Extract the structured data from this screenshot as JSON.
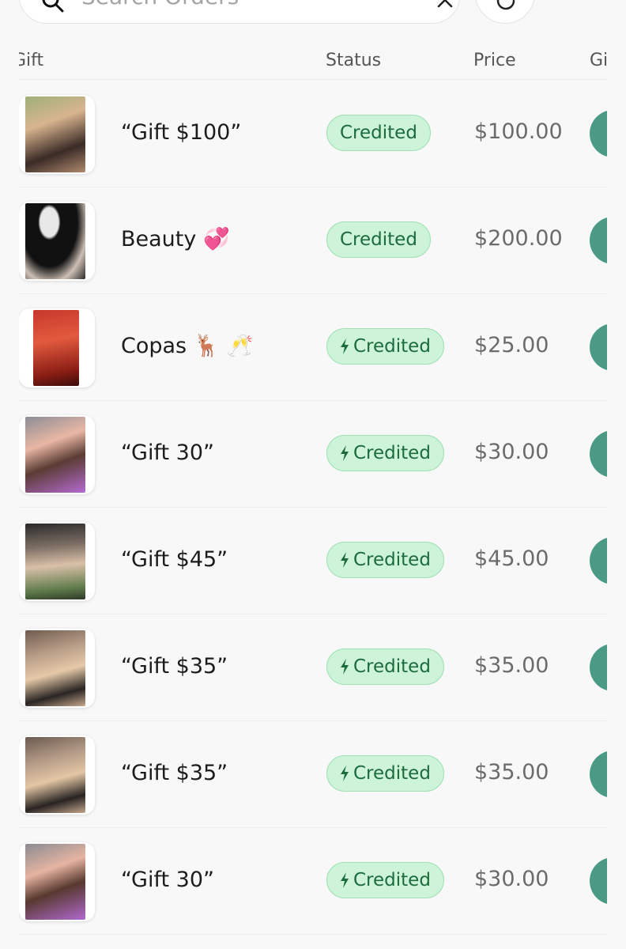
{
  "search": {
    "placeholder": "Search Orders"
  },
  "table": {
    "columns": {
      "gift": "Gift",
      "status": "Status",
      "price": "Price",
      "gift_extra": "Gi"
    },
    "rows": [
      {
        "name": "“Gift $100”",
        "status": "Credited",
        "instant": false,
        "price": "$100.00"
      },
      {
        "name": "Beauty 💞",
        "status": "Credited",
        "instant": false,
        "price": "$200.00"
      },
      {
        "name": "Copas 🦌 🥂",
        "status": "Credited",
        "instant": true,
        "price": "$25.00"
      },
      {
        "name": "“Gift 30”",
        "status": "Credited",
        "instant": true,
        "price": "$30.00"
      },
      {
        "name": "“Gift $45”",
        "status": "Credited",
        "instant": true,
        "price": "$45.00"
      },
      {
        "name": "“Gift $35”",
        "status": "Credited",
        "instant": true,
        "price": "$35.00"
      },
      {
        "name": "“Gift $35”",
        "status": "Credited",
        "instant": true,
        "price": "$35.00"
      },
      {
        "name": "“Gift 30”",
        "status": "Credited",
        "instant": true,
        "price": "$30.00"
      }
    ]
  },
  "icons": {
    "search": "search-icon",
    "clear": "close-icon",
    "filter": "filter-icon",
    "instant": "bolt-icon"
  },
  "colors": {
    "badge_bg": "#cdf4d9",
    "badge_text": "#1d6b3c",
    "action": "#4a9a85"
  }
}
